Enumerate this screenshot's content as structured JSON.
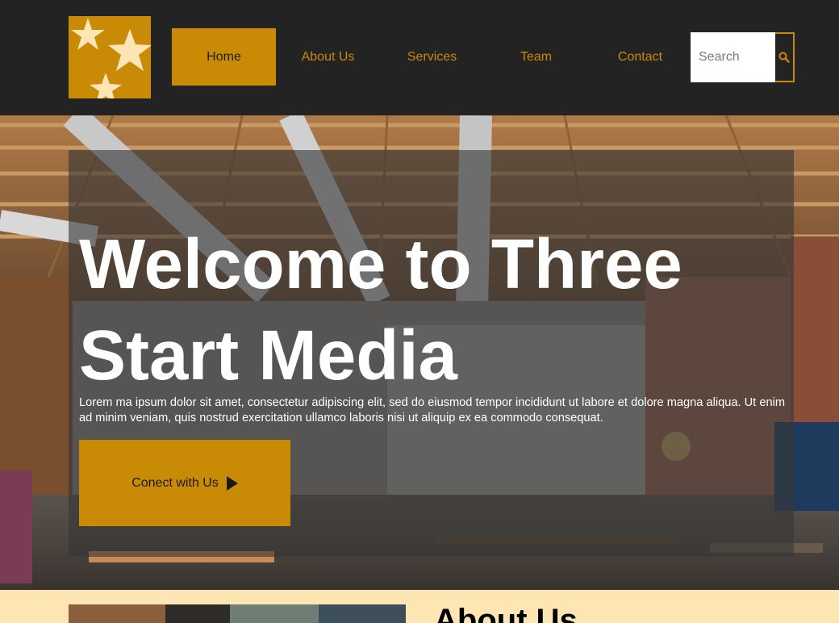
{
  "brand": {
    "logo_icon": "three-stars-logo",
    "colors": {
      "accent": "#c98a06",
      "header_bg": "#232323",
      "cream": "#fde6b3"
    }
  },
  "nav": {
    "items": [
      {
        "label": "Home",
        "active": true
      },
      {
        "label": "About Us",
        "active": false
      },
      {
        "label": "Services",
        "active": false
      },
      {
        "label": "Team",
        "active": false
      },
      {
        "label": "Contact",
        "active": false
      }
    ]
  },
  "search": {
    "placeholder": "Search",
    "icon": "search-icon"
  },
  "hero": {
    "title": "Welcome to Three Start Media",
    "text": "Lorem ma ipsum dolor sit amet, consectetur adipiscing elit, sed do eiusmod tempor incididunt ut labore et dolore magna aliqua. Ut enim ad minim veniam, quis nostrud exercitation ullamco laboris nisi ut aliquip ex ea commodo consequat.",
    "cta_label": "Conect with Us",
    "cta_icon": "play-triangle-icon"
  },
  "about": {
    "title": "About Us"
  }
}
